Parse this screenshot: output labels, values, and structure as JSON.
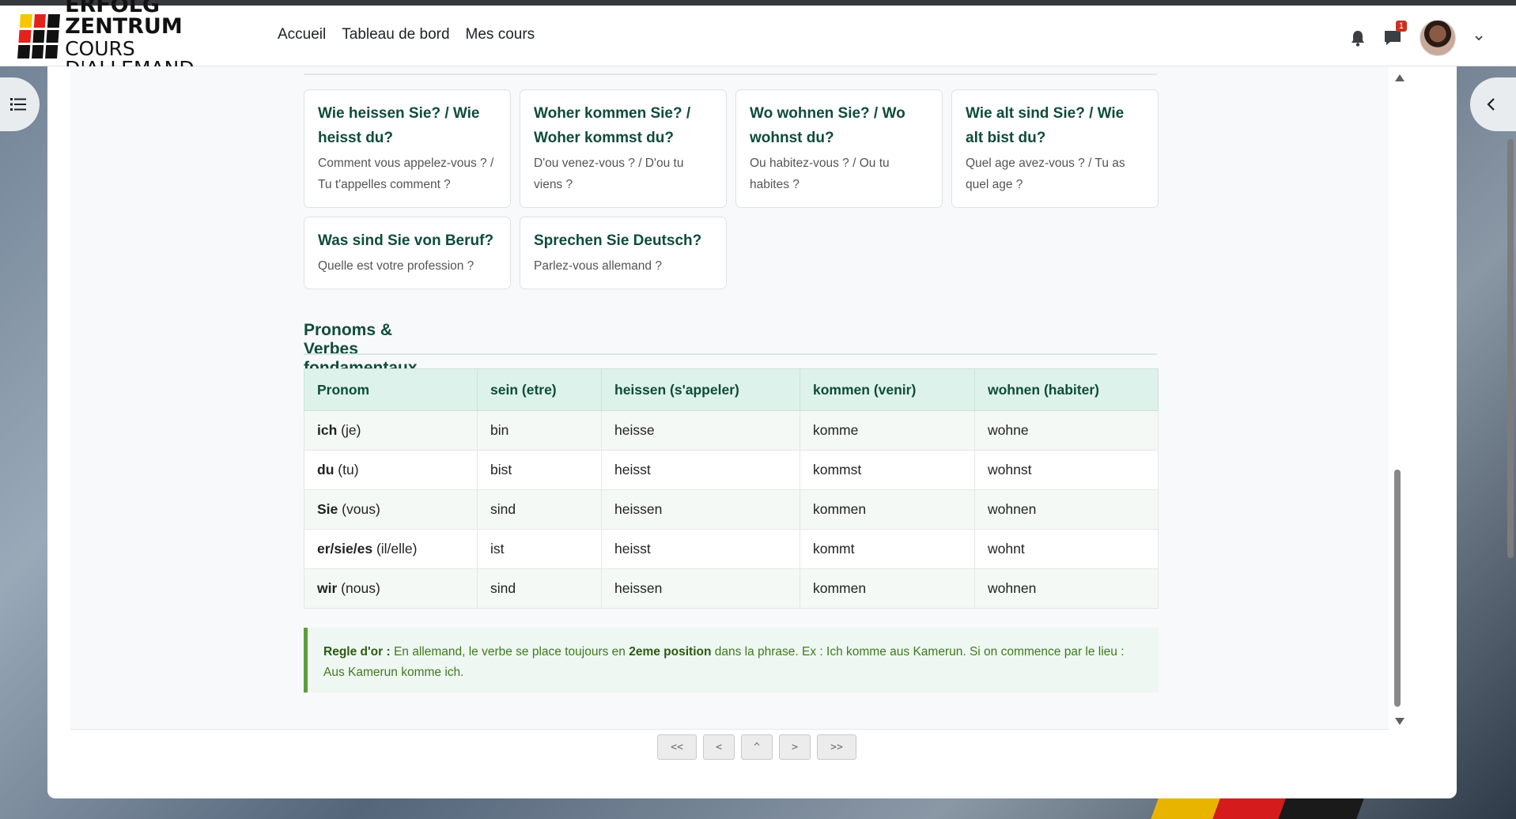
{
  "brand": {
    "line1": "ERFOLG ZENTRUM",
    "line2": "COURS D'ALLEMAND"
  },
  "nav": {
    "links": [
      "Accueil",
      "Tableau de bord",
      "Mes cours"
    ],
    "notification_badge": "1"
  },
  "phrases": [
    {
      "de": "Wie heissen Sie? / Wie heisst du?",
      "fr": "Comment vous appelez-vous ? / Tu t'appelles comment ?"
    },
    {
      "de": "Woher kommen Sie? / Woher kommst du?",
      "fr": "D'ou venez-vous ? / D'ou tu viens ?"
    },
    {
      "de": "Wo wohnen Sie? / Wo wohnst du?",
      "fr": "Ou habitez-vous ? / Ou tu habites ?"
    },
    {
      "de": "Wie alt sind Sie? / Wie alt bist du?",
      "fr": "Quel age avez-vous ? / Tu as quel age ?"
    },
    {
      "de": "Was sind Sie von Beruf?",
      "fr": "Quelle est votre profession ?"
    },
    {
      "de": "Sprechen Sie Deutsch?",
      "fr": "Parlez-vous allemand ?"
    }
  ],
  "section_title": "Pronoms & Verbes fondamentaux",
  "table": {
    "headers": [
      "Pronom",
      "sein (etre)",
      "heissen (s'appeler)",
      "kommen (venir)",
      "wohnen (habiter)"
    ],
    "rows": [
      {
        "pronoun": "ich",
        "fr": "(je)",
        "cells": [
          "bin",
          "heisse",
          "komme",
          "wohne"
        ]
      },
      {
        "pronoun": "du",
        "fr": "(tu)",
        "cells": [
          "bist",
          "heisst",
          "kommst",
          "wohnst"
        ]
      },
      {
        "pronoun": "Sie",
        "fr": "(vous)",
        "cells": [
          "sind",
          "heissen",
          "kommen",
          "wohnen"
        ]
      },
      {
        "pronoun": "er/sie/es",
        "fr": "(il/elle)",
        "cells": [
          "ist",
          "heisst",
          "kommt",
          "wohnt"
        ]
      },
      {
        "pronoun": "wir",
        "fr": "(nous)",
        "cells": [
          "sind",
          "heissen",
          "kommen",
          "wohnen"
        ]
      }
    ]
  },
  "rule": {
    "label": "Regle d'or :",
    "text_before": " En allemand, le verbe se place toujours en ",
    "emphasis": "2eme position",
    "text_after": " dans la phrase. Ex : Ich komme aus Kamerun. Si on commence par le lieu : Aus Kamerun komme ich."
  },
  "pager": {
    "first": "<<",
    "prev": "<",
    "up": "^",
    "next": ">",
    "last": ">>"
  },
  "icons": {
    "drawer_left": "list-icon",
    "drawer_right": "chevron-left-icon",
    "notifications": "bell-icon",
    "messages": "chat-icon",
    "user_menu": "chevron-down-icon"
  }
}
